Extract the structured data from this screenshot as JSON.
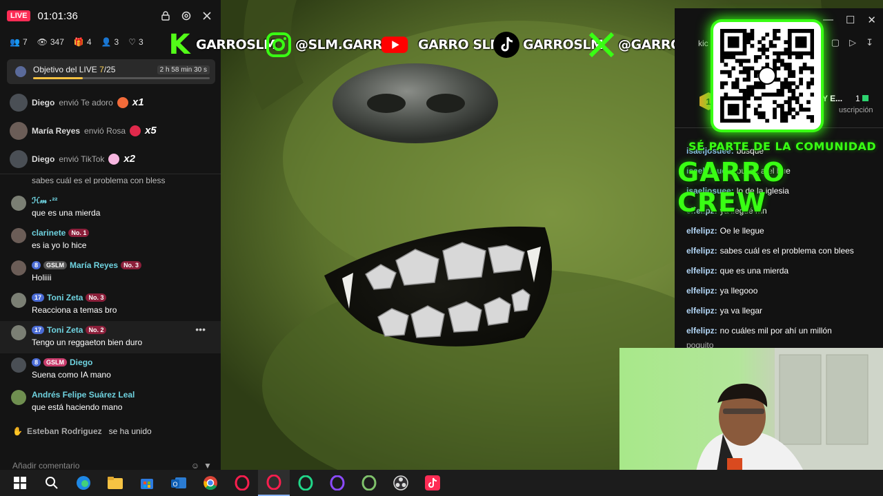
{
  "live_panel": {
    "badge": "LIVE",
    "timer": "01:01:36",
    "stats": {
      "users": "7",
      "viewers": "347",
      "gifts": "4",
      "followers": "3",
      "likes": "3"
    },
    "goal": {
      "label": "Objetivo del LIVE ",
      "progress_text": "7",
      "total_text": "/25",
      "time_left": "2 h 58 min 30 s",
      "progress_fraction": 0.28
    },
    "gifts": [
      {
        "user": "Diego",
        "action": "envió Te adoro",
        "count": "x1",
        "gift_color": "#f26b3a"
      },
      {
        "user": "María Reyes",
        "action": "envió Rosa",
        "count": "x5",
        "gift_color": "#e0294b"
      },
      {
        "user": "Diego",
        "action": "envió TikTok",
        "count": "x2",
        "gift_color": "#f7b6e0"
      }
    ],
    "cut_message": "sabes cuál es el problema con bless",
    "comments": [
      {
        "user": "ℋ𝓂 ·²²",
        "badges": [],
        "text": "que es una mierda"
      },
      {
        "user": "clarinete",
        "badges": [
          {
            "kind": "no",
            "label": "No. 1"
          }
        ],
        "text": "es ia yo lo hice"
      },
      {
        "user": "María Reyes",
        "badges": [
          {
            "kind": "lvl",
            "label": "8"
          },
          {
            "kind": "gslm",
            "label": "GSLM"
          },
          {
            "kind": "no",
            "label": "No. 3"
          }
        ],
        "text": "Holiiii"
      },
      {
        "user": "Toni Zeta",
        "badges": [
          {
            "kind": "lvl",
            "label": "17"
          },
          {
            "kind": "no",
            "label": "No. 3"
          }
        ],
        "text": "Reacciona a temas bro"
      },
      {
        "user": "Toni Zeta",
        "badges": [
          {
            "kind": "lvl",
            "label": "17"
          },
          {
            "kind": "no",
            "label": "No. 2"
          }
        ],
        "text": "Tengo un reggaeton bien duro"
      },
      {
        "user": "Diego",
        "badges": [
          {
            "kind": "lvl",
            "label": "8"
          },
          {
            "kind": "fan",
            "label": "GSLM"
          }
        ],
        "text": "Suena como IA mano"
      },
      {
        "user": "Andrés Felipe Suárez Leal",
        "badges": [],
        "text": "que está haciendo mano"
      }
    ],
    "joined": {
      "user": "Esteban Rodriguez",
      "text": "se ha unido"
    },
    "composer_placeholder": "Añadir comentario"
  },
  "socials": [
    {
      "icon": "kick-icon",
      "handle": "GARROSLM",
      "color": "#53fc18"
    },
    {
      "icon": "instagram-icon",
      "handle": "@SLM.GARRO",
      "color": "#39ff14"
    },
    {
      "icon": "youtube-icon",
      "handle": "GARRO SLM",
      "color": "#ff0000"
    },
    {
      "icon": "tiktok-icon",
      "handle": "GARROSLM",
      "color": "#000000"
    },
    {
      "icon": "x-icon",
      "handle": "@GARROSLM",
      "color": "#39ff14"
    }
  ],
  "chat_panel": {
    "partial_text": "kic",
    "sub_name": "Y E...",
    "sub_count": "1",
    "sub_label": "uscripción",
    "messages": [
      {
        "user": "isaeljosuee:",
        "text": "busque"
      },
      {
        "user": "isaeljosuee:",
        "text": "busca a el hue"
      },
      {
        "user": "isaeljosuee:",
        "text": "lo de la iglesia"
      },
      {
        "user": "elfelipz:",
        "text": "ya llegué mn"
      },
      {
        "user": "elfelipz:",
        "text": "Oe le llegue"
      },
      {
        "user": "elfelipz:",
        "text": "sabes cuál es el problema con blees"
      },
      {
        "user": "elfelipz:",
        "text": "que es una mierda"
      },
      {
        "user": "elfelipz:",
        "text": "ya llegooo"
      },
      {
        "user": "elfelipz:",
        "text": "ya va llegar"
      },
      {
        "user": "elfelipz:",
        "text": "no cuáles mil por ahí un millón"
      },
      {
        "user": "",
        "text": "poquito"
      }
    ]
  },
  "overlay": {
    "community_line": "SÉ PARTE DE LA COMUNIDAD",
    "crew_title": "GARRO CREW"
  },
  "taskbar": [
    "windows-start-icon",
    "search-icon",
    "edge-icon",
    "file-explorer-icon",
    "store-icon",
    "outlook-icon",
    "chrome-icon",
    "opera-gx-icon",
    "opera-gx-active-icon",
    "opera-green-icon",
    "opera-purple-icon",
    "opera-dark-icon",
    "obs-icon",
    "tiktok-icon"
  ]
}
